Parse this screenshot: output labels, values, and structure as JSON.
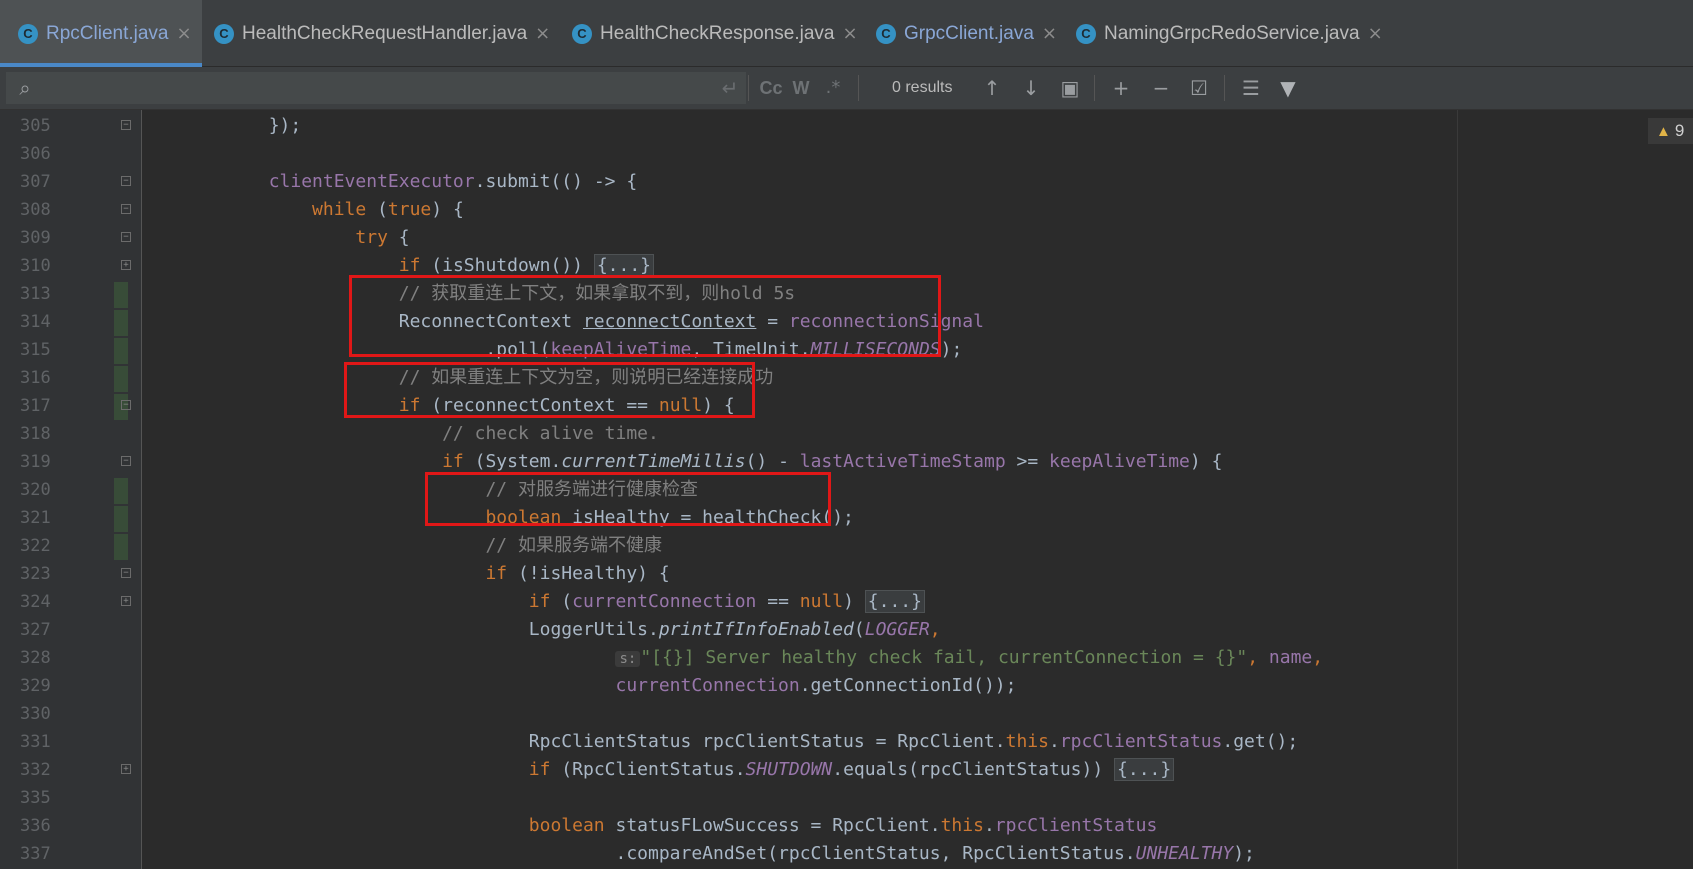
{
  "tabs": [
    {
      "label": "RpcClient.java",
      "icon": "C",
      "active": true
    },
    {
      "label": "HealthCheckRequestHandler.java",
      "icon": "C"
    },
    {
      "label": "HealthCheckResponse.java",
      "icon": "C"
    },
    {
      "label": "GrpcClient.java",
      "icon": "C"
    },
    {
      "label": "NamingGrpcRedoService.java",
      "icon": "C"
    }
  ],
  "tab_close": "×",
  "search": {
    "value": "",
    "results": "0 results",
    "match_case": "Cc",
    "words": "W",
    "regex": ".*"
  },
  "warnings": {
    "count": "9"
  },
  "lines": [
    {
      "n": "305",
      "parts": [
        [
          "",
          "        });"
        ]
      ]
    },
    {
      "n": "306",
      "parts": [
        [
          "",
          ""
        ]
      ]
    },
    {
      "n": "307",
      "parts": [
        [
          "",
          "        "
        ],
        [
          "fld",
          "clientEventExecutor"
        ],
        [
          "",
          ".submit(() -> {"
        ]
      ]
    },
    {
      "n": "308",
      "parts": [
        [
          "",
          "            "
        ],
        [
          "kw",
          "while"
        ],
        [
          "",
          " ("
        ],
        [
          "kw",
          "true"
        ],
        [
          "",
          ") {"
        ]
      ]
    },
    {
      "n": "309",
      "parts": [
        [
          "",
          "                "
        ],
        [
          "kw",
          "try"
        ],
        [
          "",
          " {"
        ]
      ]
    },
    {
      "n": "310",
      "parts": [
        [
          "",
          "                    "
        ],
        [
          "kw",
          "if"
        ],
        [
          "",
          " (isShutdown()) "
        ],
        [
          "fold",
          "{...}"
        ]
      ]
    },
    {
      "n": "313",
      "parts": [
        [
          "",
          "                    "
        ],
        [
          "cmt",
          "// 获取重连上下文，如果拿取不到，则hold 5s"
        ]
      ]
    },
    {
      "n": "314",
      "parts": [
        [
          "",
          "                    ReconnectContext "
        ],
        [
          "ul",
          "reconnectContext"
        ],
        [
          "",
          " = "
        ],
        [
          "fld",
          "reconnectionSignal"
        ]
      ]
    },
    {
      "n": "315",
      "parts": [
        [
          "",
          "                            .poll("
        ],
        [
          "fld",
          "keepAliveTime"
        ],
        [
          "",
          ", TimeUnit."
        ],
        [
          "sfld",
          "MILLISECONDS"
        ],
        [
          "",
          ");"
        ]
      ]
    },
    {
      "n": "316",
      "parts": [
        [
          "",
          "                    "
        ],
        [
          "cmt",
          "// 如果重连上下文为空，则说明已经连接成功"
        ]
      ]
    },
    {
      "n": "317",
      "parts": [
        [
          "",
          "                    "
        ],
        [
          "kw",
          "if"
        ],
        [
          "",
          " (reconnectContext == "
        ],
        [
          "kw",
          "null"
        ],
        [
          "",
          ") {"
        ]
      ]
    },
    {
      "n": "318",
      "parts": [
        [
          "",
          "                        "
        ],
        [
          "cmt",
          "// check alive time."
        ]
      ]
    },
    {
      "n": "319",
      "parts": [
        [
          "",
          "                        "
        ],
        [
          "kw",
          "if"
        ],
        [
          "",
          " (System."
        ],
        [
          "smth",
          "currentTimeMillis"
        ],
        [
          "",
          "() - "
        ],
        [
          "fld",
          "lastActiveTimeStamp"
        ],
        [
          "",
          " >= "
        ],
        [
          "fld",
          "keepAliveTime"
        ],
        [
          "",
          ") {"
        ]
      ]
    },
    {
      "n": "320",
      "parts": [
        [
          "",
          "                            "
        ],
        [
          "cmt",
          "// 对服务端进行健康检查"
        ]
      ]
    },
    {
      "n": "321",
      "parts": [
        [
          "",
          "                            "
        ],
        [
          "kw",
          "boolean"
        ],
        [
          "",
          " isHealthy = healthCheck();"
        ]
      ]
    },
    {
      "n": "322",
      "parts": [
        [
          "",
          "                            "
        ],
        [
          "cmt",
          "// 如果服务端不健康"
        ]
      ]
    },
    {
      "n": "323",
      "parts": [
        [
          "",
          "                            "
        ],
        [
          "kw",
          "if"
        ],
        [
          "",
          " (!isHealthy) {"
        ]
      ]
    },
    {
      "n": "324",
      "parts": [
        [
          "",
          "                                "
        ],
        [
          "kw",
          "if"
        ],
        [
          "",
          " ("
        ],
        [
          "fld",
          "currentConnection"
        ],
        [
          "",
          " == "
        ],
        [
          "kw",
          "null"
        ],
        [
          "",
          ") "
        ],
        [
          "fold",
          "{...}"
        ]
      ]
    },
    {
      "n": "327",
      "parts": [
        [
          "",
          "                                LoggerUtils."
        ],
        [
          "smth",
          "printIfInfoEnabled"
        ],
        [
          "",
          "("
        ],
        [
          "sfld",
          "LOGGER"
        ],
        [
          "kw",
          ","
        ]
      ]
    },
    {
      "n": "328",
      "parts": [
        [
          "",
          "                                        "
        ],
        [
          "hint",
          "s:"
        ],
        [
          "str",
          "\"[{}] Server healthy check fail, currentConnection = {}\""
        ],
        [
          "kw",
          ","
        ],
        [
          "",
          " "
        ],
        [
          "fld",
          "name"
        ],
        [
          "kw",
          ","
        ]
      ]
    },
    {
      "n": "329",
      "parts": [
        [
          "",
          "                                        "
        ],
        [
          "fld",
          "currentConnection"
        ],
        [
          "",
          ".getConnectionId());"
        ]
      ]
    },
    {
      "n": "330",
      "parts": [
        [
          "",
          ""
        ]
      ]
    },
    {
      "n": "331",
      "parts": [
        [
          "",
          "                                RpcClientStatus rpcClientStatus = RpcClient."
        ],
        [
          "kw",
          "this"
        ],
        [
          "",
          "."
        ],
        [
          "fld",
          "rpcClientStatus"
        ],
        [
          "",
          ".get();"
        ]
      ]
    },
    {
      "n": "332",
      "parts": [
        [
          "",
          "                                "
        ],
        [
          "kw",
          "if"
        ],
        [
          "",
          " (RpcClientStatus."
        ],
        [
          "sfld",
          "SHUTDOWN"
        ],
        [
          "",
          ".equals(rpcClientStatus)) "
        ],
        [
          "fold",
          "{...}"
        ]
      ]
    },
    {
      "n": "335",
      "parts": [
        [
          "",
          ""
        ]
      ]
    },
    {
      "n": "336",
      "parts": [
        [
          "",
          "                                "
        ],
        [
          "kw",
          "boolean"
        ],
        [
          "",
          " statusFLowSuccess = RpcClient."
        ],
        [
          "kw",
          "this"
        ],
        [
          "",
          "."
        ],
        [
          "fld",
          "rpcClientStatus"
        ]
      ]
    },
    {
      "n": "337",
      "parts": [
        [
          "",
          "                                        .compareAndSet(rpcClientStatus, RpcClientStatus."
        ],
        [
          "sfld",
          "UNHEALTHY"
        ],
        [
          "",
          ");"
        ]
      ]
    }
  ]
}
